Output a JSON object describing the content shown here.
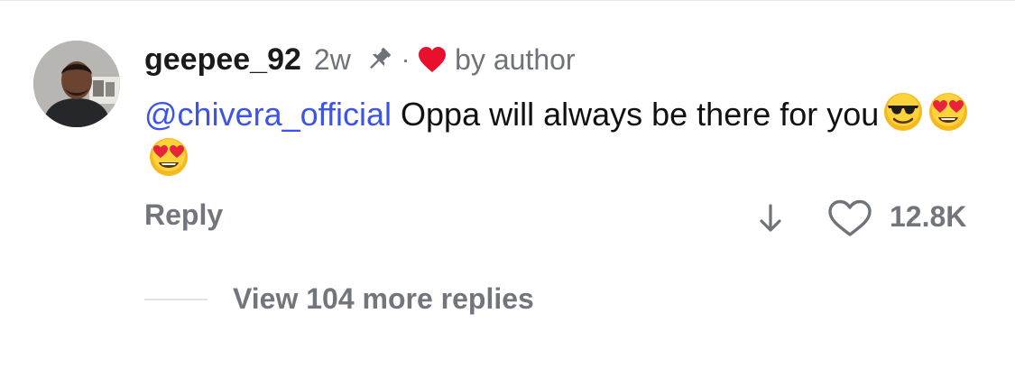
{
  "comment": {
    "username": "geepee_92",
    "time_ago": "2w",
    "separator": "·",
    "liked_badge": "by author",
    "mention": "@chivera_official",
    "text": " Oppa will always be there for you",
    "emojis": [
      "smiling-face-with-sunglasses",
      "smiling-face-with-heart-eyes",
      "smiling-face-with-heart-eyes"
    ]
  },
  "actions": {
    "reply_label": "Reply",
    "like_count": "12.8K"
  },
  "thread": {
    "view_more_label": "View 104 more replies"
  },
  "icons": {
    "pin": "pin-icon",
    "author_heart": "heart-icon",
    "download": "arrow-down-icon",
    "like": "heart-outline-icon"
  },
  "colors": {
    "mention": "#3b55e6",
    "muted_text": "#72767c",
    "author_heart": "#e8102c"
  }
}
